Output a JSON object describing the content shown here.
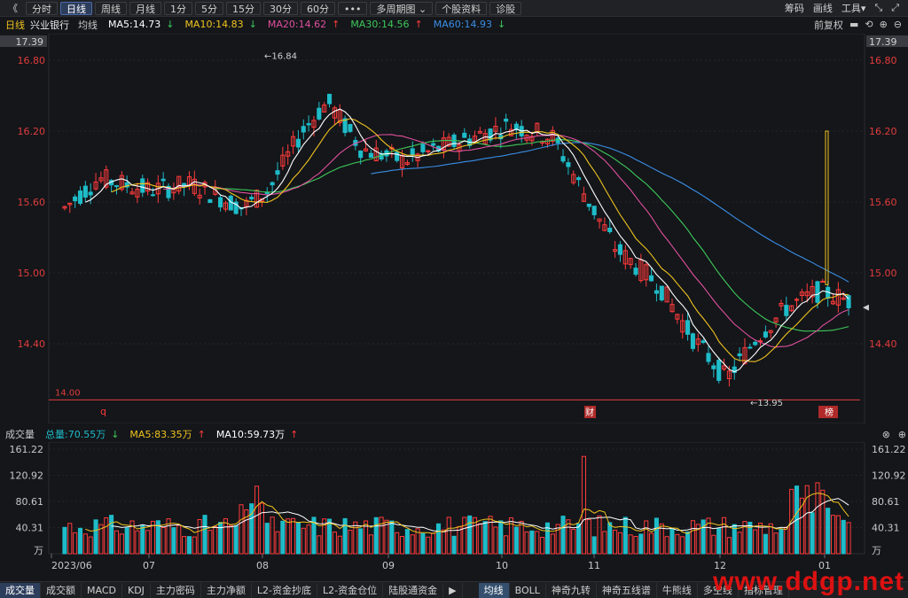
{
  "toolbar": {
    "back": "《",
    "tabs": [
      "分时",
      "日线",
      "周线",
      "月线",
      "1分",
      "5分",
      "15分",
      "30分",
      "60分",
      "•••",
      "多周期图",
      "个股资料",
      "诊股"
    ],
    "active_tab": 1,
    "multi_arrow": "⌄",
    "right": [
      "筹码",
      "画线",
      "工具▾"
    ]
  },
  "legend": {
    "period": "日线",
    "stock": "兴业银行",
    "avg": "均线",
    "ma5": "MA5:14.73",
    "ma10": "MA10:14.83",
    "ma20": "MA20:14.62",
    "ma30": "MA30:14.56",
    "ma60": "MA60:14.93",
    "adjust": "前复权"
  },
  "price_axis": {
    "top": "17.39",
    "ticks": [
      "16.80",
      "16.20",
      "15.60",
      "15.00",
      "14.40"
    ],
    "support_line": "14.00",
    "high_mark": "16.84",
    "low_mark": "13.95"
  },
  "markers": {
    "q": "q",
    "cai": "财",
    "bang": "榜"
  },
  "volume": {
    "title": "成交量",
    "total": "总量:70.55万",
    "ma5": "MA5:83.35万",
    "ma10": "MA10:59.73万",
    "ticks": [
      "161.22",
      "120.92",
      "80.61",
      "40.31"
    ],
    "unit": "万"
  },
  "time_axis": [
    "2023/06",
    "07",
    "08",
    "09",
    "10",
    "11",
    "12",
    "01"
  ],
  "bottom_tabs_left": [
    "成交量",
    "成交额",
    "MACD",
    "KDJ",
    "主力密码",
    "主力净额",
    "L2-资金抄底",
    "L2-资金仓位",
    "陆股通资金"
  ],
  "bottom_tabs_right": [
    "均线",
    "BOLL",
    "神奇九转",
    "神奇五线谱",
    "牛熊线",
    "多空线",
    "指标管理"
  ],
  "watermark": "www.ddgp.net",
  "colors": {
    "up": "#ff3b3b",
    "down": "#1ebcc8",
    "ma5": "#ffffff",
    "ma10": "#f0c31e",
    "ma20": "#e0509e",
    "ma30": "#3ec85a",
    "ma60": "#3a8ee6"
  }
}
